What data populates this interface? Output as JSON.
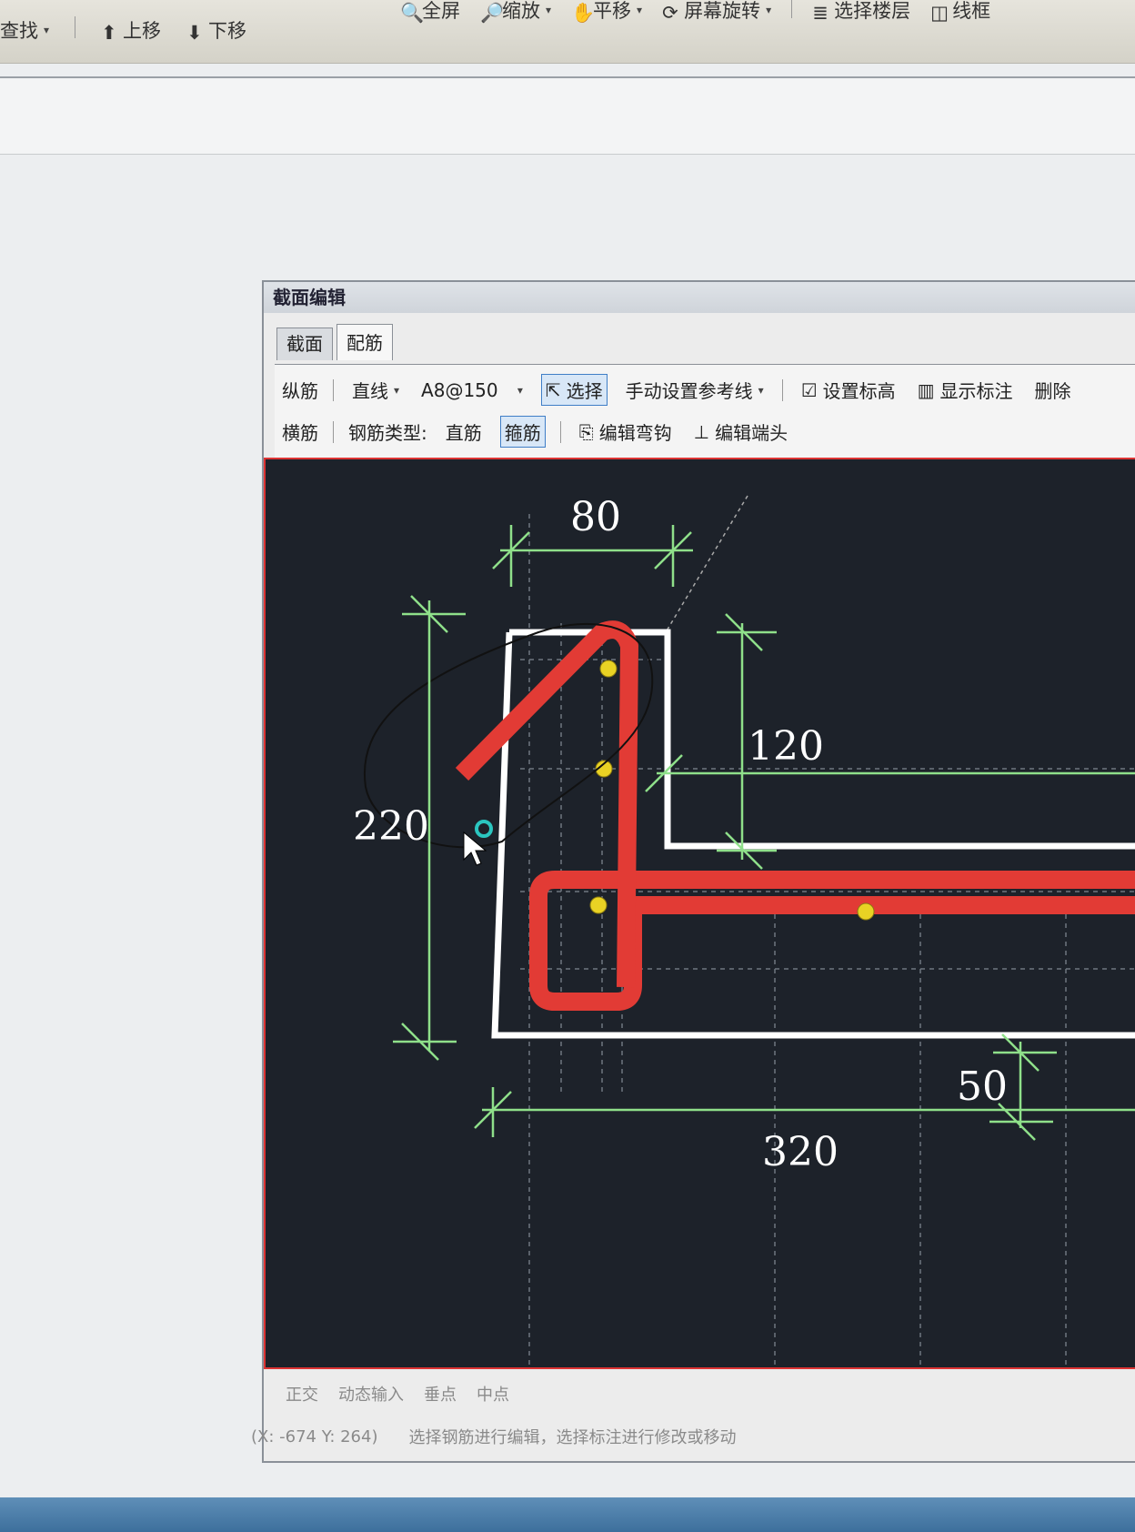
{
  "app_toolbar": {
    "row1": [
      "全屏",
      "缩放",
      "平移",
      "屏幕旋转",
      "选择楼层",
      "线框"
    ],
    "row2": [
      "查找",
      "上移",
      "下移"
    ]
  },
  "dialog": {
    "title": "截面编辑",
    "tabs": [
      {
        "label": "截面",
        "active": false
      },
      {
        "label": "配筋",
        "active": true
      }
    ],
    "toolbar_row1": {
      "type_label": "纵筋",
      "line_mode": "直线",
      "spec_value": "A8@150",
      "select_label": "选择",
      "manual_ref_label": "手动设置参考线",
      "set_elevation_label": "设置标高",
      "show_dim_label": "显示标注",
      "delete_label": "删除"
    },
    "toolbar_row2": {
      "type_label": "横筋",
      "rebar_type_label": "钢筋类型:",
      "straight_label": "直筋",
      "stirrup_label": "箍筋",
      "edit_hook_label": "编辑弯钩",
      "edit_end_label": "编辑端头"
    },
    "canvas": {
      "dimensions": {
        "top_width": "80",
        "left_height": "220",
        "right_height": "120",
        "bottom_width": "320",
        "right_small": "50"
      }
    },
    "status_row": [
      "正交",
      "动态输入",
      "垂点",
      "中点"
    ],
    "coords": "(X: -674 Y: 264)",
    "hint": "选择钢筋进行编辑，选择标注进行修改或移动"
  },
  "colors": {
    "canvas_bg": "#1d222a",
    "rebar": "#e23b35",
    "dimension": "#8fe08a",
    "outline": "#ffffff",
    "point": "#e9d224"
  }
}
